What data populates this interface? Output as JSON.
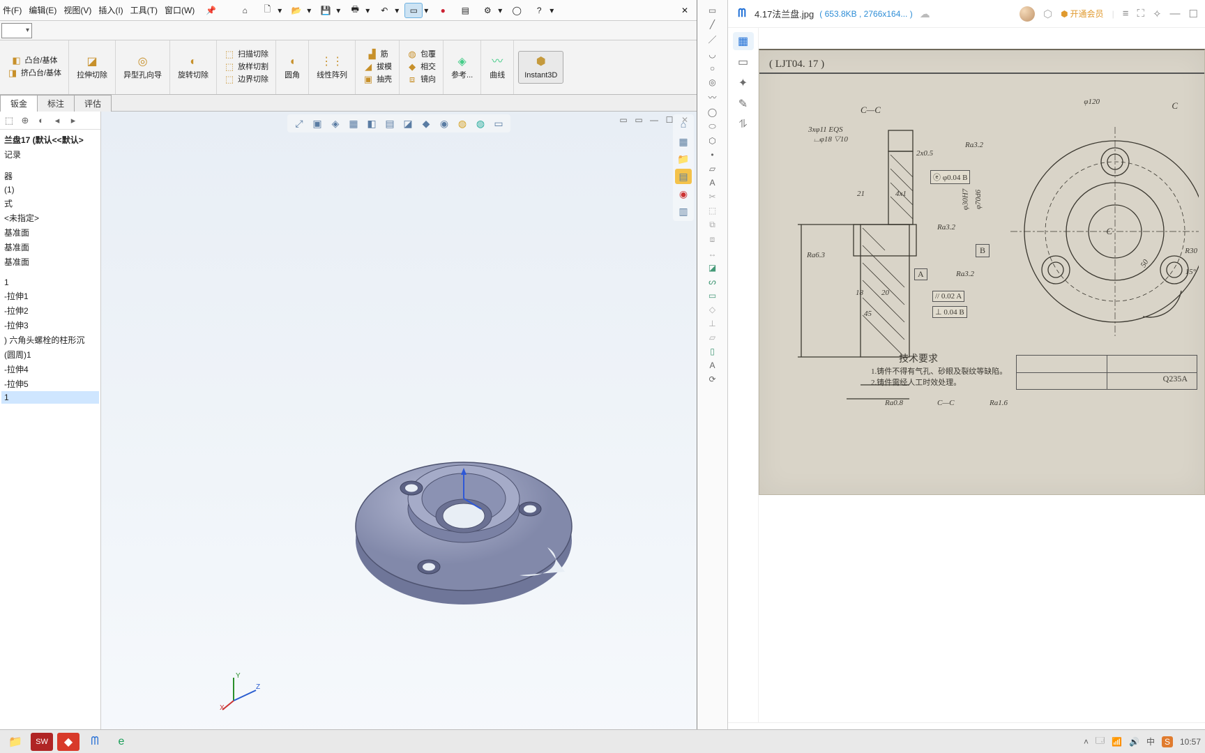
{
  "menubar": {
    "items": [
      "件(F)",
      "编辑(E)",
      "视图(V)",
      "插入(I)",
      "工具(T)",
      "窗口(W)"
    ]
  },
  "quick": {
    "items": [
      "home",
      "new",
      "open",
      "save",
      "print",
      "undo",
      "select",
      "rec",
      "opts",
      "gear",
      "user",
      "help"
    ]
  },
  "ribbon": {
    "g1": {
      "a": "凸台/基体",
      "b": "挤凸台/基体"
    },
    "g2": {
      "a": "拉伸切除"
    },
    "g3": {
      "a": "异型孔向导"
    },
    "g4": {
      "a": "旋转切除"
    },
    "g5": {
      "a": "扫描切除",
      "b": "放样切割",
      "c": "边界切除"
    },
    "g6": {
      "a": "圆角"
    },
    "g7": {
      "a": "线性阵列"
    },
    "g8": {
      "a": "筋",
      "b": "拔模",
      "c": "抽壳"
    },
    "g9": {
      "a": "包覆",
      "b": "相交",
      "c": "镜向"
    },
    "g10": {
      "a": "参考..."
    },
    "g11": {
      "a": "曲线"
    },
    "g12": {
      "a": "Instant3D"
    }
  },
  "tabs": {
    "items": [
      "钣金",
      "标注",
      "评估"
    ]
  },
  "tree": {
    "root": "兰盘17  (默认<<默认>",
    "hist": "记录",
    "n1": "器",
    "n2": "(1)",
    "n3": "式",
    "n4": "  <未指定>",
    "n5": "基准面",
    "n6": "基准面",
    "n7": "基准面",
    "n8": "1",
    "n9": "-拉伸1",
    "n10": "-拉伸2",
    "n11": "-拉伸3",
    "n12": ") 六角头螺栓的柱形沉",
    "n13": "(圆周)1",
    "n14": "-拉伸4",
    "n15": "-拉伸5",
    "n16": "1"
  },
  "viewer": {
    "filename": "4.17法兰盘.jpg",
    "size": "653.8KB",
    "dims": "2766x164...",
    "vip": "开通会员"
  },
  "drawing": {
    "code": "( LJT04. 17 )",
    "secCC": "C—C",
    "d1": "3xφ11 EQS",
    "d2": "⌴φ18 ▽10",
    "d3": "Ra3.2",
    "d4": "2x0.5",
    "d5": "ⓔ φ0.04  B",
    "d6": "21",
    "d7": "4x1",
    "d8": "Ra3.2",
    "d9": "Ra6.3",
    "d10": "18",
    "d11": "20",
    "d12": "45",
    "d13": "A",
    "d14": "B",
    "d15": "Ra3.2",
    "d16": "//  0.02  A",
    "d17": "⊥  0.04  B",
    "d18": "φ120",
    "d19": "φ30H7",
    "d20": "φ70d6",
    "d21": "R30",
    "d22": "15°",
    "d23": "技术要求",
    "d24": "1.铸件不得有气孔、砂眼及裂纹等缺陷。",
    "d25": "2.铸件需经人工时效处理。",
    "d26": "Ra0.8",
    "d27": "C—C",
    "d28": "Ra1.6",
    "d29": "Q235A",
    "d30": "C",
    "d31": "C",
    "d32": "50"
  },
  "clock": "10:57"
}
